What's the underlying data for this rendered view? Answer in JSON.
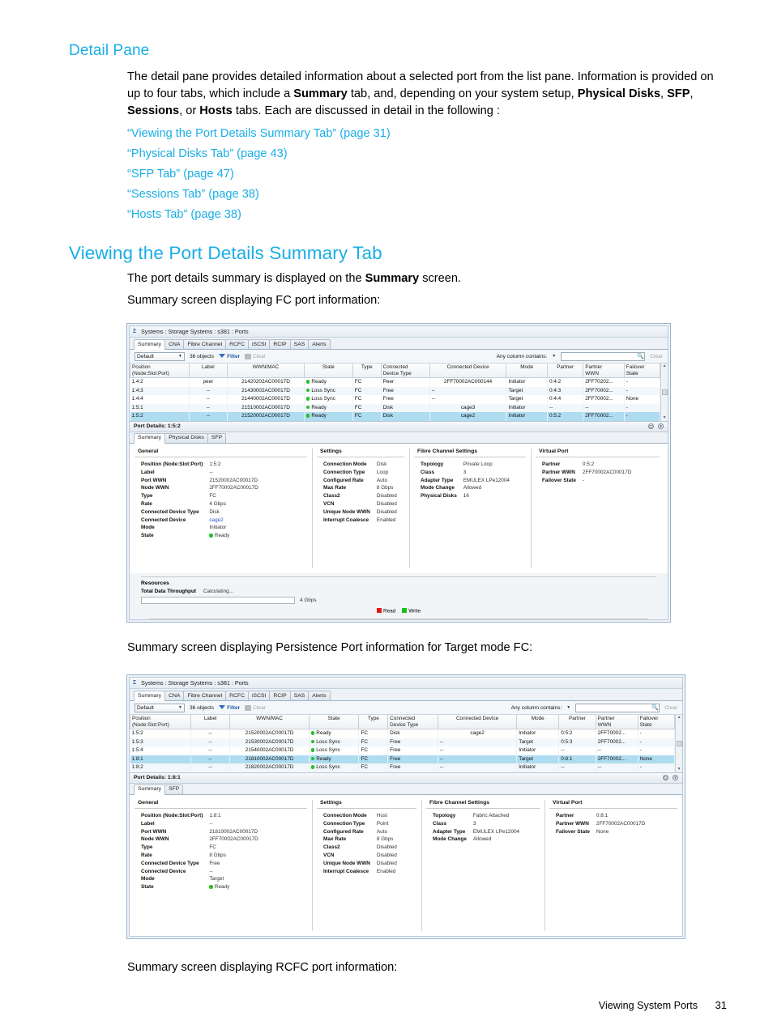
{
  "document": {
    "section_heading": "Detail Pane",
    "intro_paragraph_parts": [
      {
        "t": "The detail pane provides detailed information about a selected port from the list pane. Information is provided on up to four tabs, which include a ",
        "b": false
      },
      {
        "t": "Summary",
        "b": true
      },
      {
        "t": " tab, and, depending on your system setup, ",
        "b": false
      },
      {
        "t": "Physical Disks",
        "b": true
      },
      {
        "t": ", ",
        "b": false
      },
      {
        "t": "SFP",
        "b": true
      },
      {
        "t": ", ",
        "b": false
      },
      {
        "t": "Sessions",
        "b": true
      },
      {
        "t": ", or ",
        "b": false
      },
      {
        "t": "Hosts",
        "b": true
      },
      {
        "t": " tabs. Each are discussed in detail in the following :",
        "b": false
      }
    ],
    "cross_references": [
      "“Viewing the Port Details Summary Tab” (page 31)",
      "“Physical Disks Tab” (page 43)",
      "“SFP Tab” (page 47)",
      "“Sessions Tab” (page 38)",
      "“Hosts Tab” (page 38)"
    ],
    "main_heading": "Viewing the Port Details Summary Tab",
    "lead_parts": [
      {
        "t": "The port details summary is displayed on the ",
        "b": false
      },
      {
        "t": "Summary",
        "b": true
      },
      {
        "t": " screen.",
        "b": false
      }
    ],
    "caption_fc": "Summary screen displaying FC port information:",
    "caption_persistence": "Summary screen displaying Persistence Port information for Target mode FC:",
    "caption_rcfc": "Summary screen displaying RCFC port information:",
    "footer_text": "Viewing System Ports",
    "footer_page": "31"
  },
  "colors": {
    "heading_blue": "#1aaee5",
    "link_blue": "#2a57c9",
    "status_green": "#24c124",
    "selection_blue": "#aedcf0",
    "read_red": "#e11b1b",
    "write_green": "#18c118"
  },
  "screenshot_fc": {
    "titlebar": "Systems : Storage Systems : s381 : Ports",
    "titlebar_icon": "system-icon",
    "tabs": [
      "Summary",
      "CNA",
      "Fibre Channel",
      "RCFC",
      "iSCSI",
      "RCIP",
      "SAS",
      "Alerts"
    ],
    "active_tab": "Summary",
    "toolbar": {
      "view_select": "Default",
      "object_count": "36 objects",
      "filter_label": "Filter",
      "clear_label": "Clear",
      "search_label": "Any column contains:",
      "search_value": "",
      "search_clear_label": "Clear"
    },
    "grid": {
      "columns": [
        "Position\n(Node:Slot:Port)",
        "Label",
        "WWN/MAC",
        "State",
        "Type",
        "Connected\nDevice Type",
        "Connected Device",
        "Mode",
        "Partner",
        "Partner\nWWN",
        "Failover\nState"
      ],
      "rows": [
        {
          "position": "1:4:2",
          "label": "peer",
          "wwn": "21420202AC00017D",
          "state": "Ready",
          "type": "FC",
          "cdtype": "Peer",
          "cdevice": "2FF70002AC000144",
          "mode": "Initiator",
          "partner": "0:4:2",
          "partner_wwn": "2FF70202...",
          "failover": "-",
          "selected": false,
          "alt": false
        },
        {
          "position": "1:4:3",
          "label": "--",
          "wwn": "21430002AC00017D",
          "state": "Loss Sync",
          "type": "FC",
          "cdtype": "Free",
          "cdevice": "--",
          "mode": "Target",
          "partner": "0:4:3",
          "partner_wwn": "2FF70002...",
          "failover": "-",
          "selected": false,
          "alt": true
        },
        {
          "position": "1:4:4",
          "label": "--",
          "wwn": "21440002AC00017D",
          "state": "Loss Sync",
          "type": "FC",
          "cdtype": "Free",
          "cdevice": "--",
          "mode": "Target",
          "partner": "0:4:4",
          "partner_wwn": "2FF70002...",
          "failover": "None",
          "selected": false,
          "alt": false
        },
        {
          "position": "1:5:1",
          "label": "--",
          "wwn": "21510002AC00017D",
          "state": "Ready",
          "type": "FC",
          "cdtype": "Disk",
          "cdevice": "cage3",
          "mode": "Initiator",
          "partner": "--",
          "partner_wwn": "--",
          "failover": "-",
          "selected": false,
          "alt": true
        },
        {
          "position": "1:5:2",
          "label": "--",
          "wwn": "21520002AC00017D",
          "state": "Ready",
          "type": "FC",
          "cdtype": "Disk",
          "cdevice": "cage2",
          "mode": "Initiator",
          "partner": "0:5:2",
          "partner_wwn": "2FF70002...",
          "failover": "-",
          "selected": true,
          "alt": false
        }
      ]
    },
    "details": {
      "header": "Port Details: 1:5:2",
      "tabs": [
        "Summary",
        "Physical Disks",
        "SFP"
      ],
      "active_tab": "Summary",
      "general_title": "General",
      "general": [
        {
          "k": "Position (Node:Slot:Port)",
          "v": "1:5:2"
        },
        {
          "k": "Label",
          "v": "--"
        },
        {
          "k": "Port WWN",
          "v": "21520002AC00017D"
        },
        {
          "k": "Node WWN",
          "v": "2FF70002AC00017D"
        },
        {
          "k": "Type",
          "v": "FC"
        },
        {
          "k": "Rate",
          "v": "4 Gbps"
        },
        {
          "k": "Connected Device Type",
          "v": "Disk"
        },
        {
          "k": "Connected Device",
          "v": "cage2",
          "link": true
        },
        {
          "k": "Mode",
          "v": "Initiator"
        },
        {
          "k": "State",
          "v": "Ready",
          "status": true
        }
      ],
      "settings_title": "Settings",
      "settings": [
        {
          "k": "Connection Mode",
          "v": "Disk"
        },
        {
          "k": "Connection Type",
          "v": "Loop"
        },
        {
          "k": "Configured Rate",
          "v": "Auto"
        },
        {
          "k": "Max Rate",
          "v": "8 Gbps"
        },
        {
          "k": "Class2",
          "v": "Disabled"
        },
        {
          "k": "VCN",
          "v": "Disabled"
        },
        {
          "k": "Unique Node WWN",
          "v": "Disabled"
        },
        {
          "k": "Interrupt Coalesce",
          "v": "Enabled"
        }
      ],
      "fc_title": "Fibre Channel Settings",
      "fc": [
        {
          "k": "Topology",
          "v": "Private Loop"
        },
        {
          "k": "Class",
          "v": "3"
        },
        {
          "k": "Adapter Type",
          "v": "EMULEX LPe12004"
        },
        {
          "k": "Mode Change",
          "v": "Allowed"
        },
        {
          "k": "Physical Disks",
          "v": "16"
        }
      ],
      "vp_title": "Virtual Port",
      "virtual_port": [
        {
          "k": "Partner",
          "v": "0:5:2"
        },
        {
          "k": "Partner WWN",
          "v": "2FF70002AC00017D"
        },
        {
          "k": "Failover State",
          "v": "-"
        }
      ],
      "resources_title": "Resources",
      "throughput_label": "Total Data Throughput",
      "throughput_value": "Calculating...",
      "bar_caption": "4 Gbps",
      "legend": [
        "Read",
        "Write"
      ]
    }
  },
  "screenshot_persistence": {
    "titlebar": "Systems : Storage Systems : s381 : Ports",
    "titlebar_icon": "system-icon",
    "tabs": [
      "Summary",
      "CNA",
      "Fibre Channel",
      "RCFC",
      "iSCSI",
      "RCIP",
      "SAS",
      "Alerts"
    ],
    "active_tab": "Summary",
    "toolbar": {
      "view_select": "Default",
      "object_count": "36 objects",
      "filter_label": "Filter",
      "clear_label": "Clear",
      "search_label": "Any column contains:",
      "search_value": "",
      "search_clear_label": "Clear"
    },
    "grid": {
      "columns": [
        "Position\n(Node:Slot:Port)",
        "Label",
        "WWN/MAC",
        "State",
        "Type",
        "Connected\nDevice Type",
        "Connected Device",
        "Mode",
        "Partner",
        "Partner\nWWN",
        "Failover\nState"
      ],
      "rows": [
        {
          "position": "1:5:2",
          "label": "--",
          "wwn": "21520002AC00017D",
          "state": "Ready",
          "type": "FC",
          "cdtype": "Disk",
          "cdevice": "cage2",
          "mode": "Initiator",
          "partner": "0:5:2",
          "partner_wwn": "2FF70002...",
          "failover": "-",
          "selected": false,
          "alt": false
        },
        {
          "position": "1:5:3",
          "label": "--",
          "wwn": "21530002AC00017D",
          "state": "Loss Sync",
          "type": "FC",
          "cdtype": "Free",
          "cdevice": "--",
          "mode": "Target",
          "partner": "0:5:3",
          "partner_wwn": "2FF70002...",
          "failover": "-",
          "selected": false,
          "alt": true
        },
        {
          "position": "1:5:4",
          "label": "--",
          "wwn": "21540002AC00017D",
          "state": "Loss Sync",
          "type": "FC",
          "cdtype": "Free",
          "cdevice": "--",
          "mode": "Initiator",
          "partner": "--",
          "partner_wwn": "--",
          "failover": "-",
          "selected": false,
          "alt": false
        },
        {
          "position": "1:8:1",
          "label": "--",
          "wwn": "21810002AC00017D",
          "state": "Ready",
          "type": "FC",
          "cdtype": "Free",
          "cdevice": "--",
          "mode": "Target",
          "partner": "0:8:1",
          "partner_wwn": "2FF70002...",
          "failover": "None",
          "selected": true,
          "alt": false
        },
        {
          "position": "1:8:2",
          "label": "--",
          "wwn": "21820002AC00017D",
          "state": "Loss Sync",
          "type": "FC",
          "cdtype": "Free",
          "cdevice": "--",
          "mode": "Initiator",
          "partner": "--",
          "partner_wwn": "--",
          "failover": "-",
          "selected": false,
          "alt": true
        }
      ]
    },
    "details": {
      "header": "Port Details: 1:8:1",
      "tabs": [
        "Summary",
        "SFP"
      ],
      "active_tab": "Summary",
      "general_title": "General",
      "general": [
        {
          "k": "Position (Node:Slot:Port)",
          "v": "1:8:1"
        },
        {
          "k": "Label",
          "v": "--"
        },
        {
          "k": "Port WWN",
          "v": "21810002AC00017D"
        },
        {
          "k": "Node WWN",
          "v": "2FF70002AC00017D"
        },
        {
          "k": "Type",
          "v": "FC"
        },
        {
          "k": "Rate",
          "v": "8 Gbps"
        },
        {
          "k": "Connected Device Type",
          "v": "Free"
        },
        {
          "k": "Connected Device",
          "v": "--"
        },
        {
          "k": "Mode",
          "v": "Target"
        },
        {
          "k": "State",
          "v": "Ready",
          "status": true
        }
      ],
      "settings_title": "Settings",
      "settings": [
        {
          "k": "Connection Mode",
          "v": "Host"
        },
        {
          "k": "Connection Type",
          "v": "Point"
        },
        {
          "k": "Configured Rate",
          "v": "Auto"
        },
        {
          "k": "Max Rate",
          "v": "8 Gbps"
        },
        {
          "k": "Class2",
          "v": "Disabled"
        },
        {
          "k": "VCN",
          "v": "Disabled"
        },
        {
          "k": "Unique Node WWN",
          "v": "Disabled"
        },
        {
          "k": "Interrupt Coalesce",
          "v": "Enabled"
        }
      ],
      "fc_title": "Fibre Channel Settings",
      "fc": [
        {
          "k": "Topology",
          "v": "Fabric Attached"
        },
        {
          "k": "Class",
          "v": "3"
        },
        {
          "k": "Adapter Type",
          "v": "EMULEX LPe12004"
        },
        {
          "k": "Mode Change",
          "v": "Allowed"
        }
      ],
      "vp_title": "Virtual Port",
      "virtual_port": [
        {
          "k": "Partner",
          "v": "0:8:1"
        },
        {
          "k": "Partner WWN",
          "v": "2FF70002AC00017D"
        },
        {
          "k": "Failover State",
          "v": "None"
        }
      ]
    }
  }
}
